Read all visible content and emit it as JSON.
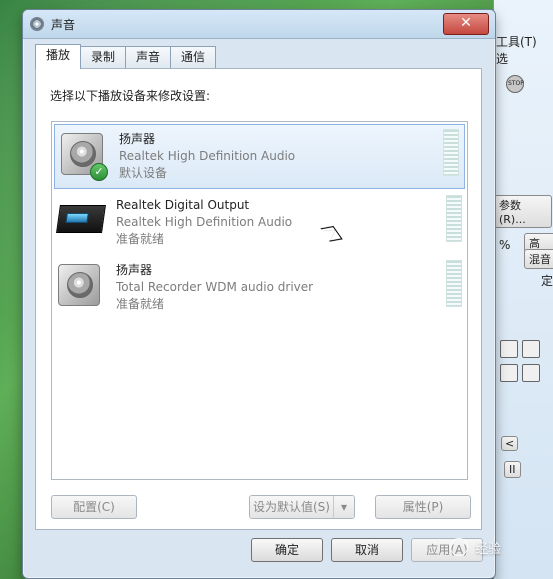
{
  "background_app": {
    "menu_items": [
      "工具(T)",
      "选"
    ],
    "labels": [
      "STOP",
      "参数(R)...",
      "%",
      "高",
      "混音",
      "定"
    ],
    "buttons": [
      "II",
      "<"
    ]
  },
  "dialog": {
    "title": "声音",
    "close_label": "✕",
    "tabs": [
      "播放",
      "录制",
      "声音",
      "通信"
    ],
    "active_tab": "播放",
    "instruction": "选择以下播放设备来修改设置:",
    "devices": [
      {
        "name": "扬声器",
        "driver": "Realtek High Definition Audio",
        "status": "默认设备",
        "icon": "speaker-icon",
        "selected": true,
        "default": true
      },
      {
        "name": "Realtek Digital Output",
        "driver": "Realtek High Definition Audio",
        "status": "准备就绪",
        "icon": "digital-output-icon",
        "selected": false,
        "default": false
      },
      {
        "name": "扬声器",
        "driver": "Total Recorder WDM audio driver",
        "status": "准备就绪",
        "icon": "speaker-icon",
        "selected": false,
        "default": false
      }
    ],
    "buttons": {
      "configure": "配置(C)",
      "set_default": "设为默认值(S)",
      "properties": "属性(P)",
      "ok": "确定",
      "cancel": "取消",
      "apply": "应用(A)"
    }
  },
  "watermark": "经验"
}
